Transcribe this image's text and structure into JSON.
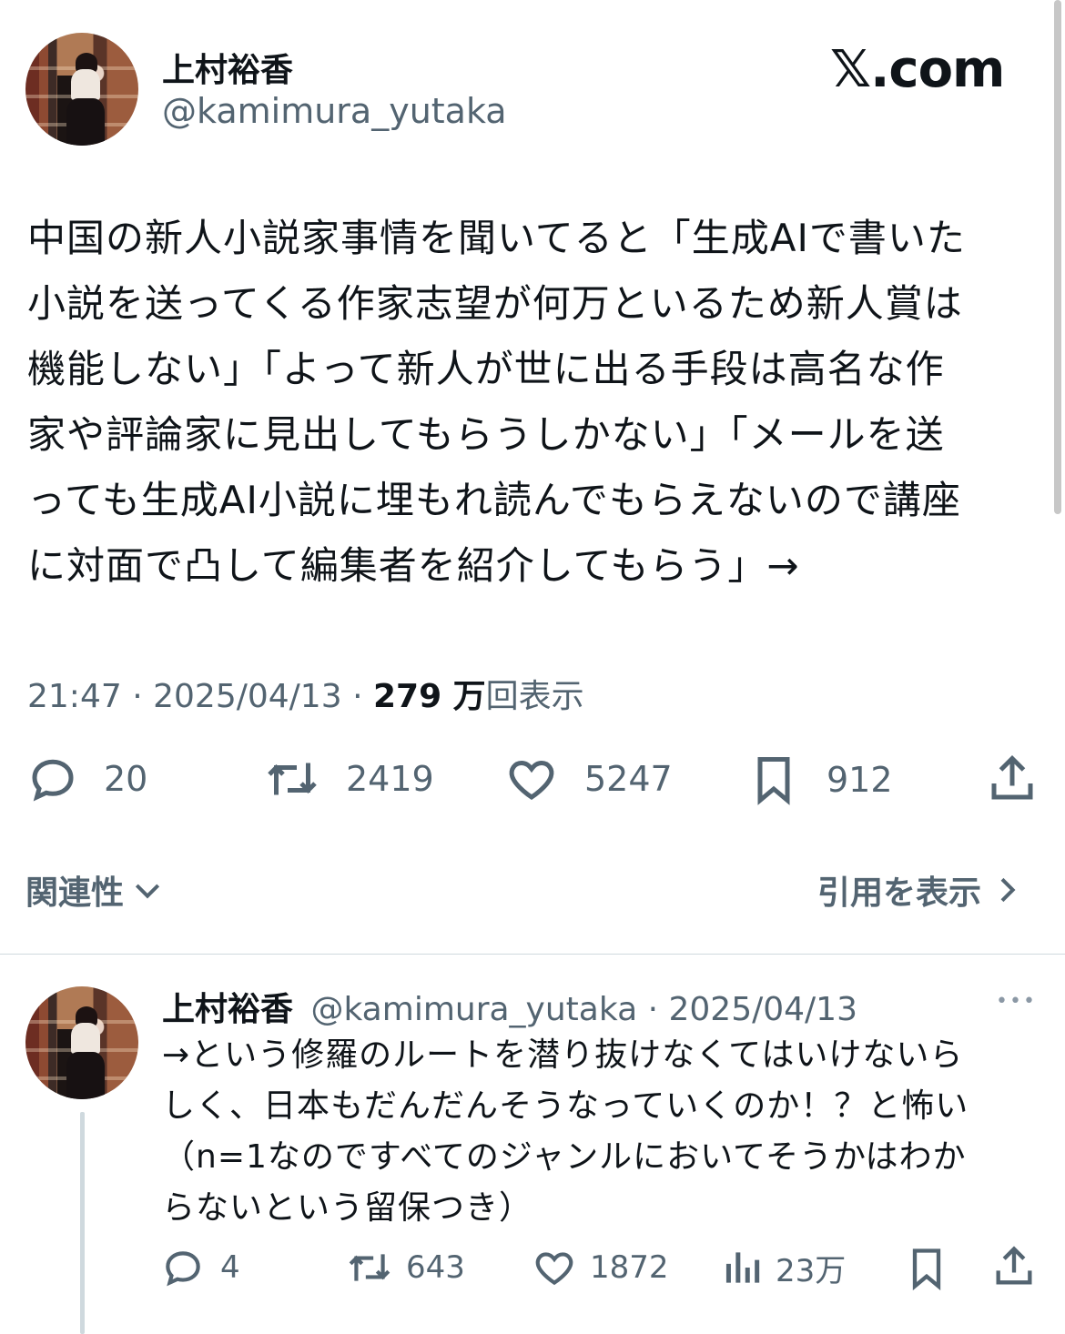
{
  "brand": "𝕏.com",
  "main_tweet": {
    "author_name": "上村裕香",
    "author_handle": "@kamimura_yutaka",
    "text_lines": [
      "中国の新人小説家事情を聞いてると「生成AIで書いた",
      "小説を送ってくる作家志望が何万といるため新人賞は",
      "機能しない」「よって新人が世に出る手段は高名な作",
      "家や評論家に見出してもらうしかない」「メールを送",
      "っても生成AI小説に埋もれ読んでもらえないので講座",
      "に対面で凸して編集者を紹介してもらう」→"
    ],
    "time": "21:47",
    "date": "2025/04/13",
    "views_count": "279 万",
    "views_label": "回表示",
    "separator": "·",
    "replies": "20",
    "reposts": "2419",
    "likes": "5247",
    "bookmarks": "912"
  },
  "relevance_label": "関連性",
  "quotes_label": "引用を表示",
  "reply_tweet": {
    "author_name": "上村裕香",
    "author_handle": "@kamimura_yutaka",
    "separator": "·",
    "date": "2025/04/13",
    "more": "•••",
    "text_lines": [
      "→という修羅のルートを潜り抜けなくてはいけないら",
      "しく、日本もだんだんそうなっていくのか！？と怖い",
      "（n=1なのですべてのジャンルにおいてそうかはわか",
      "らないという留保つき）"
    ],
    "replies": "4",
    "reposts": "643",
    "likes": "1872",
    "views": "23万"
  },
  "colors": {
    "text": "#0f1419",
    "muted": "#536471",
    "divider": "#cfd9de"
  },
  "icons": [
    "reply-icon",
    "repost-icon",
    "like-icon",
    "bookmark-icon",
    "share-icon",
    "views-icon",
    "chevron-down-icon",
    "chevron-right-icon",
    "more-icon"
  ]
}
